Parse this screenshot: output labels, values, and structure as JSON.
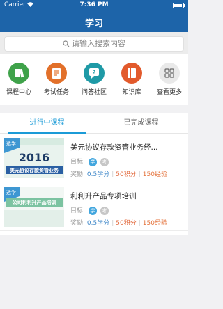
{
  "status_bar": {
    "carrier": "Carrier",
    "time": "7:36 PM"
  },
  "nav": {
    "title": "学习"
  },
  "search": {
    "placeholder": "请输入搜索内容"
  },
  "shortcuts": [
    {
      "label": "课程中心",
      "icon": "books-icon",
      "color": "#3fa24a"
    },
    {
      "label": "考试任务",
      "icon": "exam-icon",
      "color": "#e2702a"
    },
    {
      "label": "问答社区",
      "icon": "qa-icon",
      "color": "#1f9aa6"
    },
    {
      "label": "知识库",
      "icon": "library-icon",
      "color": "#e25a2c"
    },
    {
      "label": "查看更多",
      "icon": "more-grid-icon",
      "color": "#e9e9e9"
    }
  ],
  "tabs": [
    {
      "label": "进行中课程",
      "active": true
    },
    {
      "label": "已完成课程",
      "active": false
    }
  ],
  "courses": [
    {
      "title": "美元协议存款资管业务经...",
      "target_label": "目标:",
      "chip_learn": "学",
      "chip_exam": "考",
      "rewards_label": "奖励:",
      "credit": "0.5学分",
      "points": "50积分",
      "exp": "150经验",
      "thumb_badge": "选学",
      "thumb_year": "2016",
      "thumb_text": "美元协议存款资管业务"
    },
    {
      "title": "利利升产品专项培训",
      "target_label": "目标:",
      "chip_learn": "学",
      "chip_exam": "考",
      "rewards_label": "奖励:",
      "credit": "0.5学分",
      "points": "50积分",
      "exp": "150经验",
      "thumb_badge": "选学",
      "thumb_text": "公司利利升产品培训"
    }
  ],
  "colors": {
    "brand_blue": "#1d64a9",
    "tab_active": "#1b9bd7",
    "points": "#e26b3f"
  }
}
